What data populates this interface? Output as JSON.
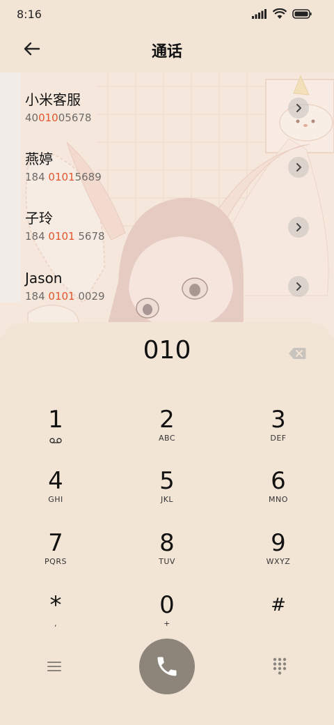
{
  "status_bar": {
    "time": "8:16"
  },
  "header": {
    "title": "通话"
  },
  "contacts": [
    {
      "name": "小米客服",
      "num_pre": "40",
      "num_hl": "010",
      "num_post": "05678"
    },
    {
      "name": "燕婷",
      "num_pre": "184 ",
      "num_hl": "0101",
      "num_post": "5689"
    },
    {
      "name": "子玲",
      "num_pre": "184 ",
      "num_hl": "0101",
      "num_post": " 5678"
    },
    {
      "name": "Jason",
      "num_pre": "184 ",
      "num_hl": "0101",
      "num_post": " 0029"
    }
  ],
  "dialer": {
    "input": "010",
    "keys": [
      {
        "digit": "1",
        "letters": "voicemail-icon"
      },
      {
        "digit": "2",
        "letters": "ABC"
      },
      {
        "digit": "3",
        "letters": "DEF"
      },
      {
        "digit": "4",
        "letters": "GHI"
      },
      {
        "digit": "5",
        "letters": "JKL"
      },
      {
        "digit": "6",
        "letters": "MNO"
      },
      {
        "digit": "7",
        "letters": "PQRS"
      },
      {
        "digit": "8",
        "letters": "TUV"
      },
      {
        "digit": "9",
        "letters": "WXYZ"
      },
      {
        "digit": "*",
        "letters": ","
      },
      {
        "digit": "0",
        "letters": "+"
      },
      {
        "digit": "#",
        "letters": ""
      }
    ]
  },
  "colors": {
    "background": "#f3e5d6",
    "highlight": "#e0562f",
    "call_button": "#8d847a"
  }
}
